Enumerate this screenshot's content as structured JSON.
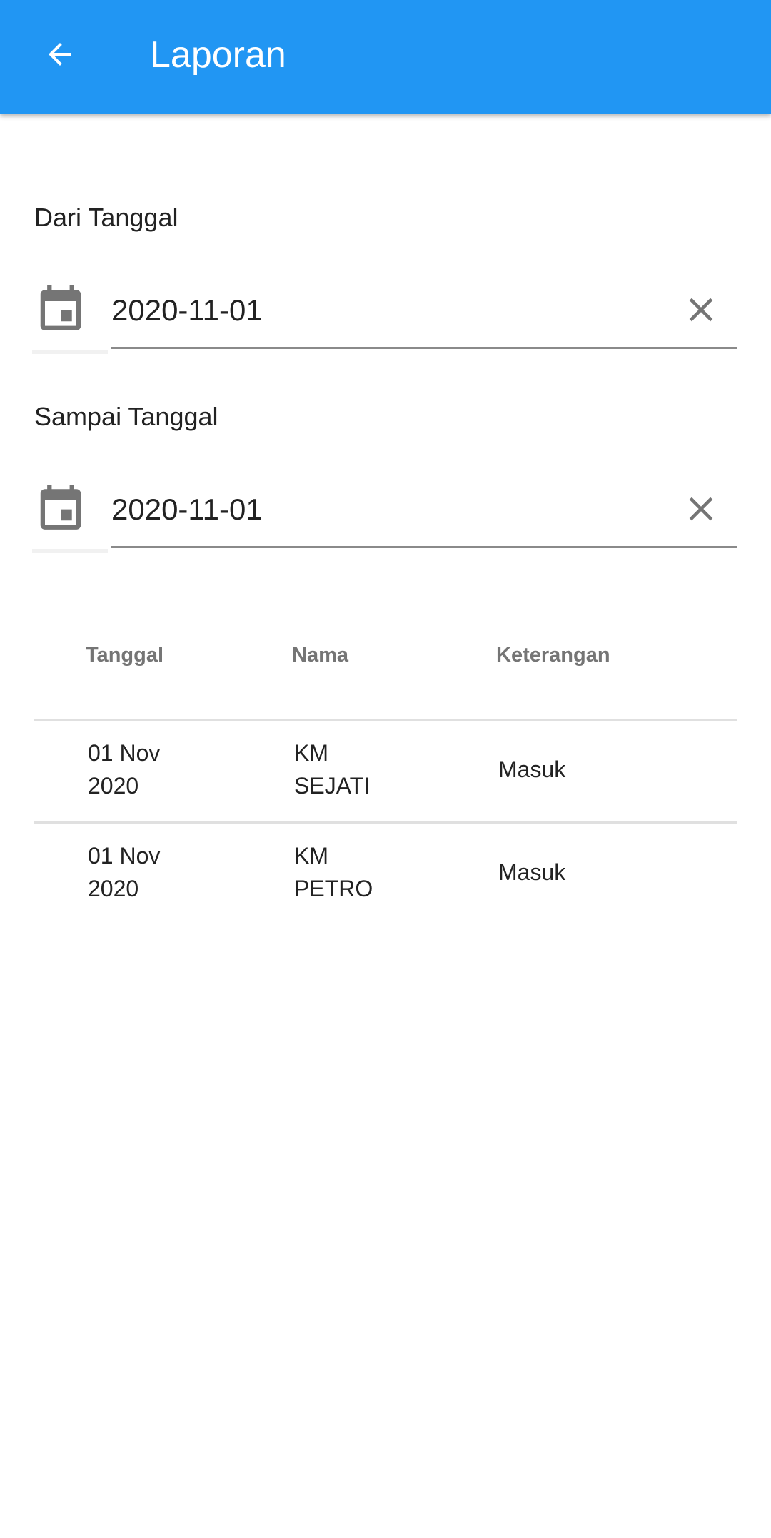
{
  "appbar": {
    "title": "Laporan",
    "back_icon": "arrow-back-icon",
    "color": "#2196F3"
  },
  "from_date": {
    "label": "Dari Tanggal",
    "value": "2020-11-01",
    "icon": "calendar-icon",
    "clear_icon": "close-icon"
  },
  "to_date": {
    "label": "Sampai Tanggal",
    "value": "2020-11-01",
    "icon": "calendar-icon",
    "clear_icon": "close-icon"
  },
  "table": {
    "columns": [
      "Tanggal",
      "Nama",
      "Keterangan"
    ],
    "rows": [
      {
        "tanggal": "01 Nov\n2020",
        "nama": "KM\nSEJATI",
        "keterangan": "Masuk"
      },
      {
        "tanggal": "01 Nov\n2020",
        "nama": "KM\nPETRO",
        "keterangan": "Masuk"
      }
    ]
  }
}
